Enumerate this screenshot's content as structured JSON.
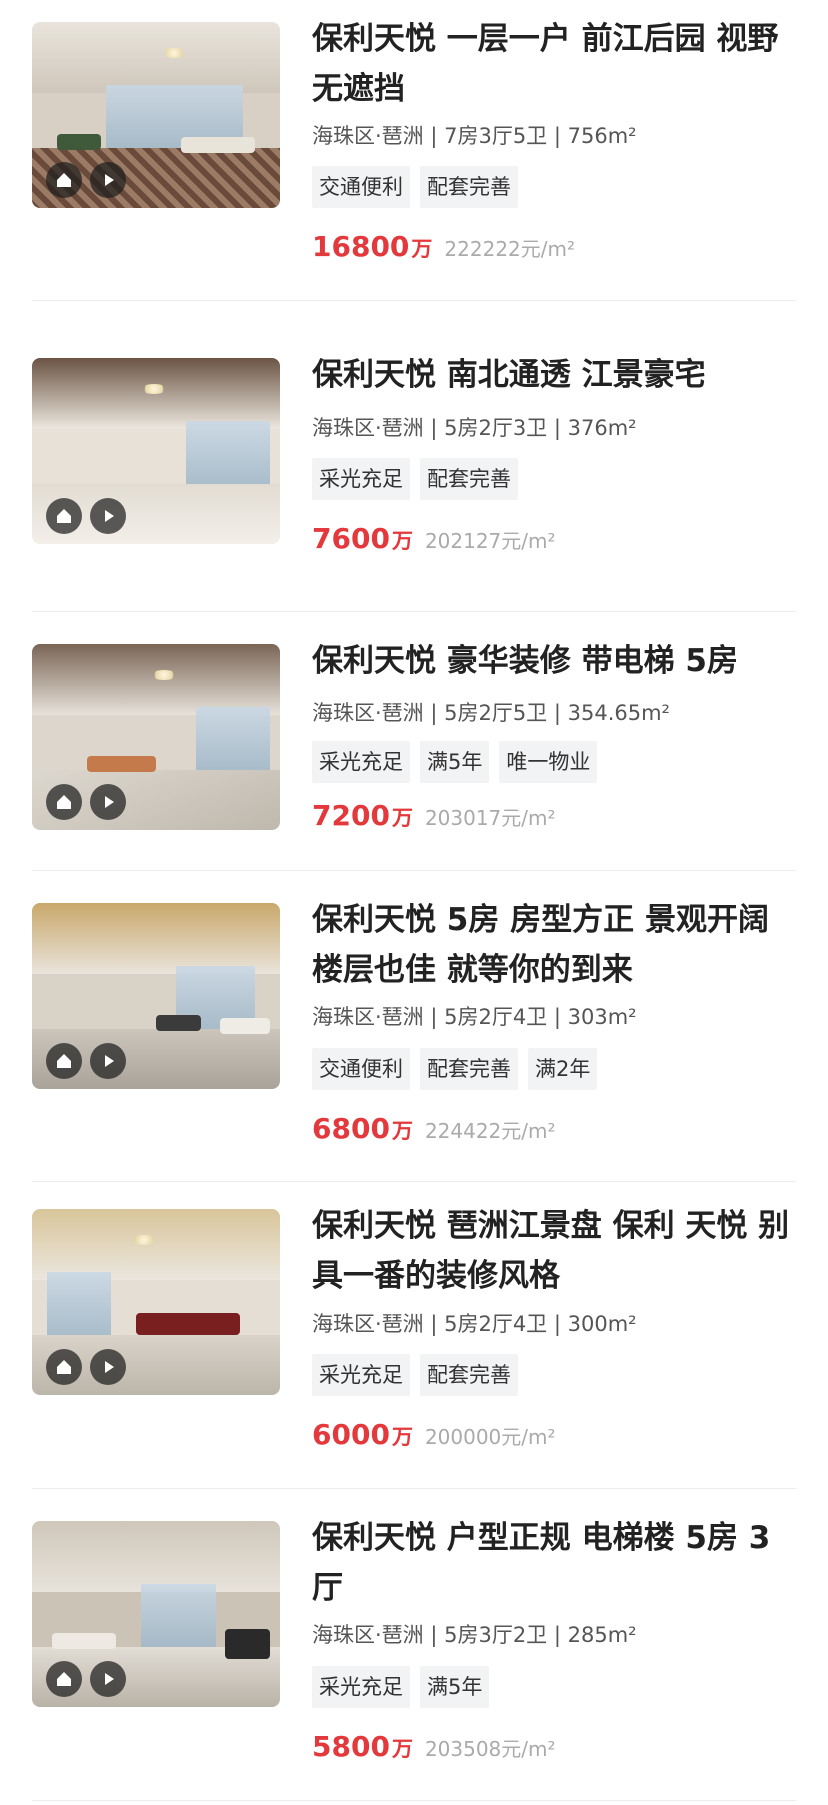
{
  "listings": [
    {
      "title": "保利天悦 一层一户 前江后园 视野无遮挡",
      "meta": "海珠区·琶洲 | 7房3厅5卫 | 756m²",
      "tags": [
        "交通便利",
        "配套完善"
      ],
      "price": "16800",
      "price_unit": "万",
      "unit_price": "222222元/m²"
    },
    {
      "title": "保利天悦 南北通透 江景豪宅",
      "meta": "海珠区·琶洲 | 5房2厅3卫 | 376m²",
      "tags": [
        "采光充足",
        "配套完善"
      ],
      "price": "7600",
      "price_unit": "万",
      "unit_price": "202127元/m²"
    },
    {
      "title": "保利天悦 豪华装修 带电梯 5房",
      "meta": "海珠区·琶洲 | 5房2厅5卫 | 354.65m²",
      "tags": [
        "采光充足",
        "满5年",
        "唯一物业"
      ],
      "price": "7200",
      "price_unit": "万",
      "unit_price": "203017元/m²"
    },
    {
      "title": "保利天悦 5房 房型方正 景观开阔 楼层也佳 就等你的到来",
      "meta": "海珠区·琶洲 | 5房2厅4卫 | 303m²",
      "tags": [
        "交通便利",
        "配套完善",
        "满2年"
      ],
      "price": "6800",
      "price_unit": "万",
      "unit_price": "224422元/m²"
    },
    {
      "title": "保利天悦 琶洲江景盘 保利 天悦 别具一番的装修风格",
      "meta": "海珠区·琶洲 | 5房2厅4卫 | 300m²",
      "tags": [
        "采光充足",
        "配套完善"
      ],
      "price": "6000",
      "price_unit": "万",
      "unit_price": "200000元/m²"
    },
    {
      "title": "保利天悦 户型正规 电梯楼 5房 3厅",
      "meta": "海珠区·琶洲 | 5房3厅2卫 | 285m²",
      "tags": [
        "采光充足",
        "满5年"
      ],
      "price": "5800",
      "price_unit": "万",
      "unit_price": "203508元/m²"
    }
  ],
  "icons": {
    "vr": "vr-house-icon",
    "play": "play-icon"
  },
  "colors": {
    "price_red": "#e4393c",
    "tag_bg": "#f2f3f5",
    "muted_gray": "#aaaaaa"
  }
}
